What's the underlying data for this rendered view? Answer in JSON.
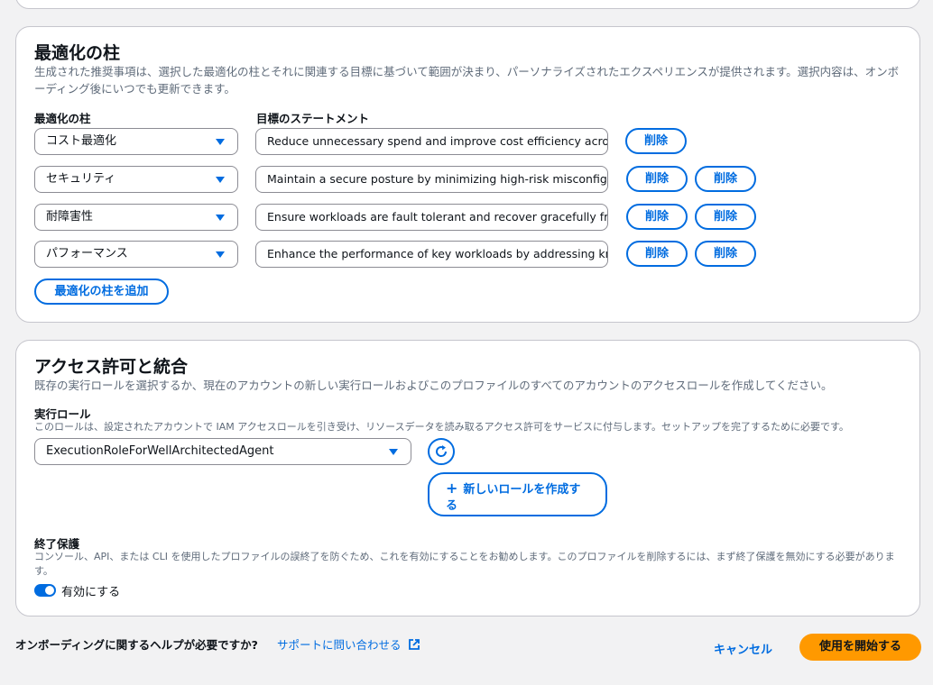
{
  "pillars": {
    "title": "最適化の柱",
    "description": "生成された推奨事項は、選択した最適化の柱とそれに関連する目標に基づいて範囲が決まり、パーソナライズされたエクスペリエンスが提供されます。選択内容は、オンボーディング後にいつでも更新できます。",
    "col_pillar": "最適化の柱",
    "col_goal": "目標のステートメント",
    "rows": [
      {
        "pillar": "コスト最適化",
        "goal": "Reduce unnecessary spend and improve cost efficiency across",
        "actions": [
          "削除"
        ]
      },
      {
        "pillar": "セキュリティ",
        "goal": "Maintain a secure posture by minimizing high-risk misconfigu",
        "actions": [
          "削除",
          "削除"
        ]
      },
      {
        "pillar": "耐障害性",
        "goal": "Ensure workloads are fault tolerant and recover gracefully fro",
        "actions": [
          "削除",
          "削除"
        ]
      },
      {
        "pillar": "パフォーマンス",
        "goal": "Enhance the performance of key workloads by addressing kn",
        "actions": [
          "削除",
          "削除"
        ]
      }
    ],
    "add_label": "最適化の柱を追加"
  },
  "access": {
    "title": "アクセス許可と統合",
    "description": "既存の実行ロールを選択するか、現在のアカウントの新しい実行ロールおよびこのプロファイルのすべてのアカウントのアクセスロールを作成してください。",
    "role_label": "実行ロール",
    "role_help": "このロールは、設定されたアカウントで IAM アクセスロールを引き受け、リソースデータを読み取るアクセス許可をサービスに付与します。セットアップを完了するために必要です。",
    "role_value": "ExecutionRoleForWellArchitectedAgent",
    "new_role_plus": "+",
    "new_role_line1": "新しいロールを作成す",
    "new_role_line2": "る",
    "termination_label": "終了保護",
    "termination_help": "コンソール、API、または CLI を使用したプロファイルの誤終了を防ぐため、これを有効にすることをお勧めします。このプロファイルを削除するには、まず終了保護を無効にする必要があります。",
    "toggle_label": "有効にする",
    "toggle_on": true
  },
  "footer": {
    "help_text": "オンボーディングに関するヘルプが必要ですか?",
    "support_link": "サポートに問い合わせる",
    "cancel": "キャンセル",
    "start": "使用を開始する"
  },
  "colors": {
    "accent": "#006ce0",
    "primary_button": "#ff9900",
    "page_bg": "#f2f2f3"
  },
  "icons": {
    "dropdown": "caret-down-icon",
    "refresh": "refresh-icon",
    "external": "external-link-icon",
    "plus": "plus-icon"
  }
}
